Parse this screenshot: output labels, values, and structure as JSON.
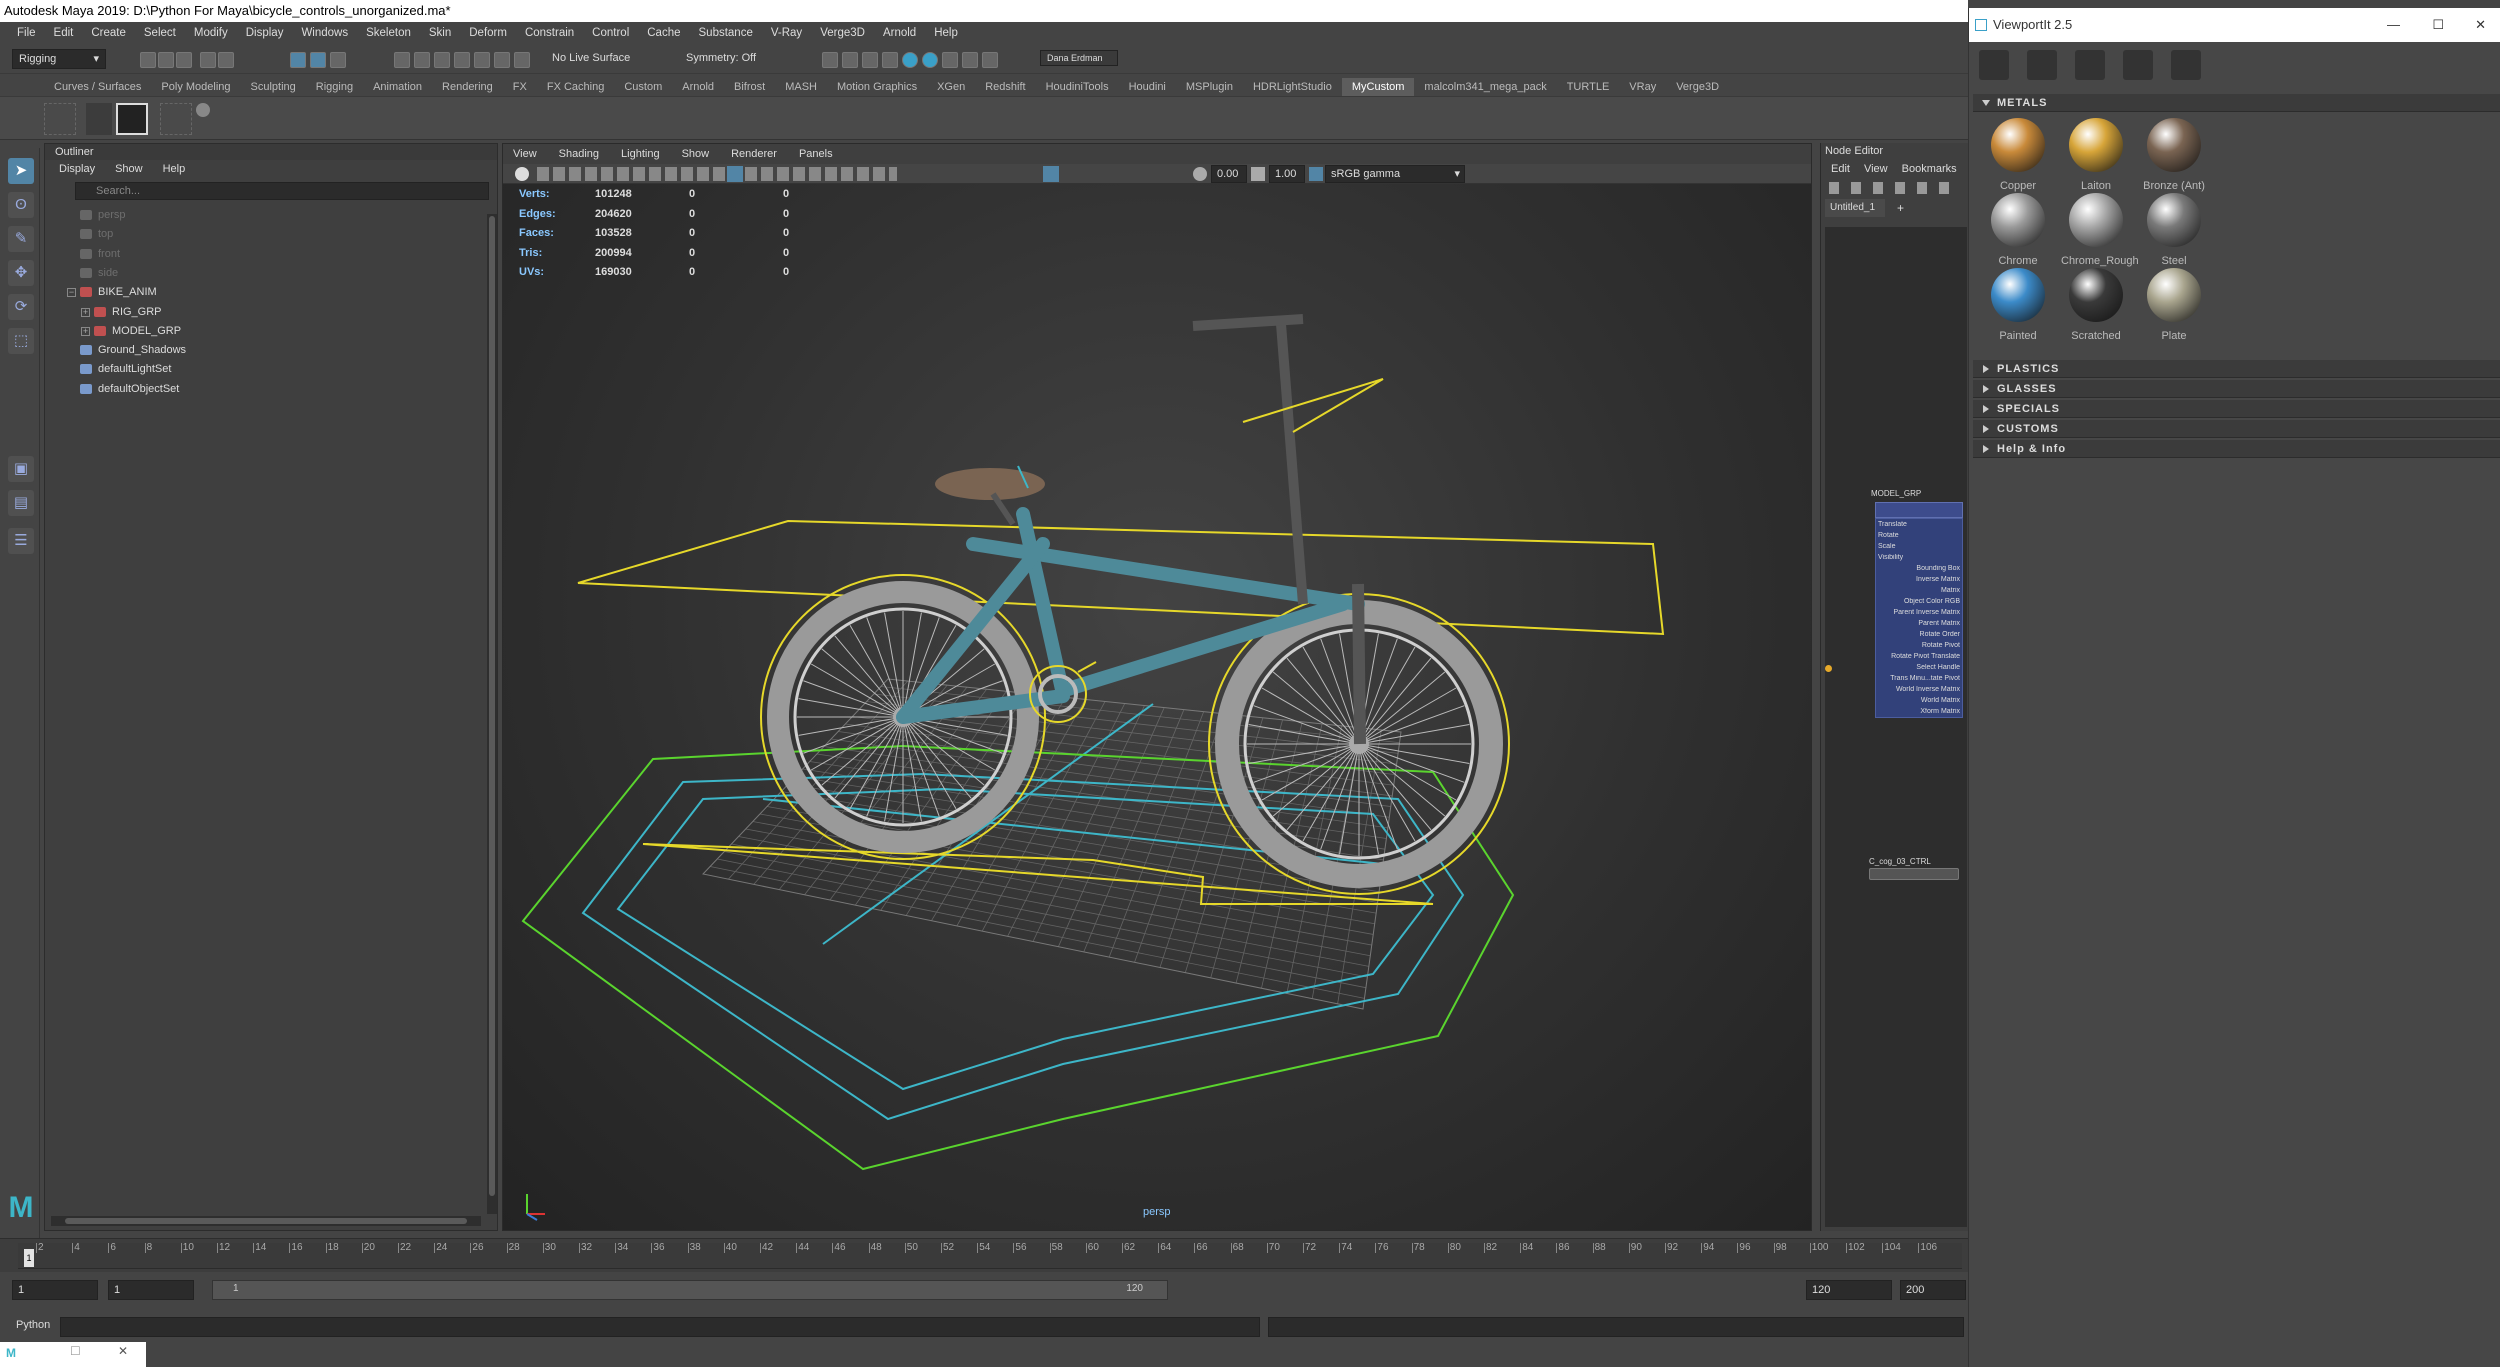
{
  "window": {
    "title": "Autodesk Maya 2019: D:\\Python For Maya\\bicycle_controls_unorganized.ma*"
  },
  "menubar": [
    "File",
    "Edit",
    "Create",
    "Select",
    "Modify",
    "Display",
    "Windows",
    "Skeleton",
    "Skin",
    "Deform",
    "Constrain",
    "Control",
    "Cache",
    "Substance",
    "V-Ray",
    "Verge3D",
    "Arnold",
    "Help"
  ],
  "status": {
    "menuset": "Rigging",
    "live_surface": "No Live Surface",
    "symmetry": "Symmetry: Off",
    "user": "Dana Erdman"
  },
  "shelf_tabs": [
    "Curves / Surfaces",
    "Poly Modeling",
    "Sculpting",
    "Rigging",
    "Animation",
    "Rendering",
    "FX",
    "FX Caching",
    "Custom",
    "Arnold",
    "Bifrost",
    "MASH",
    "Motion Graphics",
    "XGen",
    "Redshift",
    "HoudiniTools",
    "Houdini",
    "MSPlugin",
    "HDRLightStudio",
    "MyCustom",
    "malcolm341_mega_pack",
    "TURTLE",
    "VRay",
    "Verge3D"
  ],
  "shelf_active": "MyCustom",
  "outliner": {
    "title": "Outliner",
    "menu": [
      "Display",
      "Show",
      "Help"
    ],
    "search_placeholder": "Search...",
    "items": [
      {
        "label": "persp",
        "dim": true,
        "icon": "camera-icon",
        "indent": 0
      },
      {
        "label": "top",
        "dim": true,
        "icon": "camera-icon",
        "indent": 0
      },
      {
        "label": "front",
        "dim": true,
        "icon": "camera-icon",
        "indent": 0
      },
      {
        "label": "side",
        "dim": true,
        "icon": "camera-icon",
        "indent": 0
      },
      {
        "label": "BIKE_ANIM",
        "dim": false,
        "icon": "group-icon",
        "indent": 0,
        "expander": "−"
      },
      {
        "label": "RIG_GRP",
        "dim": false,
        "icon": "group-icon",
        "indent": 1,
        "expander": "+"
      },
      {
        "label": "MODEL_GRP",
        "dim": false,
        "icon": "group-icon",
        "indent": 1,
        "expander": "+"
      },
      {
        "label": "Ground_Shadows",
        "dim": false,
        "icon": "mesh-icon",
        "indent": 0
      },
      {
        "label": "defaultLightSet",
        "dim": false,
        "icon": "set-icon",
        "indent": 0
      },
      {
        "label": "defaultObjectSet",
        "dim": false,
        "icon": "set-icon",
        "indent": 0
      }
    ]
  },
  "viewport": {
    "menu": [
      "View",
      "Shading",
      "Lighting",
      "Show",
      "Renderer",
      "Panels"
    ],
    "exposure": "0.00",
    "gamma": "1.00",
    "colorspace": "sRGB gamma",
    "camera_label": "persp",
    "hud": [
      {
        "label": "Verts:",
        "v1": "101248",
        "v2": "0",
        "v3": "0"
      },
      {
        "label": "Edges:",
        "v1": "204620",
        "v2": "0",
        "v3": "0"
      },
      {
        "label": "Faces:",
        "v1": "103528",
        "v2": "0",
        "v3": "0"
      },
      {
        "label": "Tris:",
        "v1": "200994",
        "v2": "0",
        "v3": "0"
      },
      {
        "label": "UVs:",
        "v1": "169030",
        "v2": "0",
        "v3": "0"
      }
    ]
  },
  "node_editor": {
    "title": "Node Editor",
    "menu": [
      "Edit",
      "View",
      "Bookmarks"
    ],
    "tab": "Untitled_1",
    "tab_add": "+",
    "node1": {
      "name": "MODEL_GRP",
      "attrs": [
        "Translate",
        "Rotate",
        "Scale",
        "Visibility",
        "Bounding Box",
        "Inverse Matrix",
        "Matrix",
        "Object Color RGB",
        "Parent Inverse Matrix",
        "Parent Matrix",
        "Rotate Order",
        "Rotate Pivot",
        "Rotate Pivot Translate",
        "Select Handle",
        "Trans Minu...tate Pivot",
        "World Inverse Matrix",
        "World Matrix",
        "Xform Matrix"
      ]
    },
    "node2": {
      "name": "C_cog_03_CTRL"
    }
  },
  "viewportit": {
    "title": "ViewportIt 2.5",
    "sections": [
      "METALS",
      "PLASTICS",
      "GLASSES",
      "SPECIALS",
      "CUSTOMS",
      "Help & Info"
    ],
    "materials": [
      {
        "name": "Copper",
        "color": "#c98a3a"
      },
      {
        "name": "Laiton",
        "color": "#d7a539"
      },
      {
        "name": "Bronze (Ant)",
        "color": "#7a6452"
      },
      {
        "name": "Chrome",
        "color": "#9a9a9a"
      },
      {
        "name": "Chrome_Rough",
        "color": "#a8a8a8"
      },
      {
        "name": "Steel",
        "color": "#7a7a7a"
      },
      {
        "name": "Painted",
        "color": "#3c8bc9"
      },
      {
        "name": "Scratched",
        "color": "#3a3a3a"
      },
      {
        "name": "Plate",
        "color": "#a9a58e"
      }
    ]
  },
  "timeline": {
    "ticks": [
      "2",
      "4",
      "6",
      "8",
      "10",
      "12",
      "14",
      "16",
      "18",
      "20",
      "22",
      "24",
      "26",
      "28",
      "30",
      "32",
      "34",
      "36",
      "38",
      "40",
      "42",
      "44",
      "46",
      "48",
      "50",
      "52",
      "54",
      "56",
      "58",
      "60",
      "62",
      "64",
      "66",
      "68",
      "70",
      "72",
      "74",
      "76",
      "78",
      "80",
      "82",
      "84",
      "86",
      "88",
      "90",
      "92",
      "94",
      "96",
      "98",
      "100",
      "102",
      "104",
      "106"
    ],
    "current": "1"
  },
  "range": {
    "start": "1",
    "playback_start": "1",
    "slider_start": "1",
    "slider_end": "120",
    "playback_end": "120",
    "end": "200"
  },
  "cmdline": {
    "lang": "Python"
  },
  "colors": {
    "accent": "#5285a6",
    "highlight_hud": "#8ac8ff",
    "curve_yellow": "#e6d82a",
    "curve_green": "#5ad42e",
    "curve_cyan": "#3db6c8"
  }
}
